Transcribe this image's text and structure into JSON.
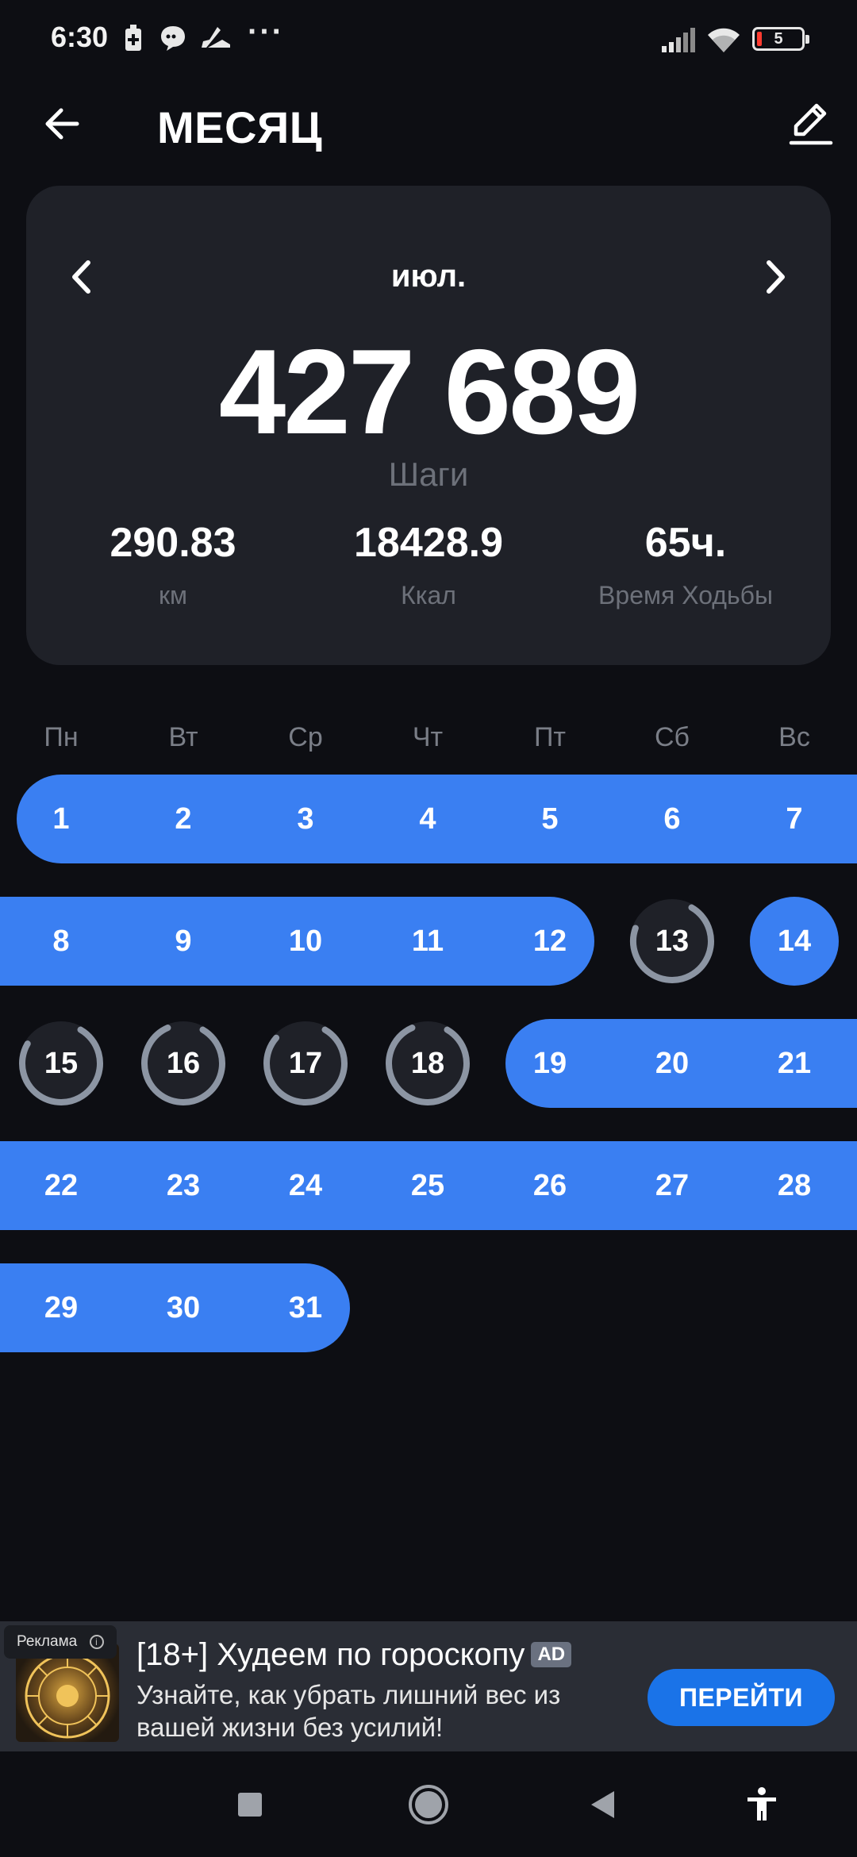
{
  "status_bar": {
    "time": "6:30",
    "battery_level": "5",
    "icons": [
      "battery-saver-icon",
      "chat-bubble-icon",
      "shoe-icon",
      "more-dots-icon",
      "signal-icon",
      "wifi-icon",
      "battery-icon"
    ]
  },
  "header": {
    "title": "МЕСЯЦ",
    "back_icon": "arrow-left-icon",
    "edit_icon": "pencil-icon"
  },
  "summary": {
    "month": "июл.",
    "steps_value": "427 689",
    "steps_label": "Шаги",
    "stats": [
      {
        "value": "290.83",
        "label": "км"
      },
      {
        "value": "18428.9",
        "label": "Ккал"
      },
      {
        "value": "65ч.",
        "label": "Время Ходьбы"
      }
    ]
  },
  "calendar": {
    "weekdays": [
      "Пн",
      "Вт",
      "Ср",
      "Чт",
      "Пт",
      "Сб",
      "Вс"
    ],
    "accent_color": "#3a7ff2",
    "days": [
      {
        "n": "1",
        "goal_met": true
      },
      {
        "n": "2",
        "goal_met": true
      },
      {
        "n": "3",
        "goal_met": true
      },
      {
        "n": "4",
        "goal_met": true
      },
      {
        "n": "5",
        "goal_met": true
      },
      {
        "n": "6",
        "goal_met": true
      },
      {
        "n": "7",
        "goal_met": true
      },
      {
        "n": "8",
        "goal_met": true
      },
      {
        "n": "9",
        "goal_met": true
      },
      {
        "n": "10",
        "goal_met": true
      },
      {
        "n": "11",
        "goal_met": true
      },
      {
        "n": "12",
        "goal_met": true
      },
      {
        "n": "13",
        "goal_met": false,
        "progress": 0.72
      },
      {
        "n": "14",
        "goal_met": true
      },
      {
        "n": "15",
        "goal_met": false,
        "progress": 0.75
      },
      {
        "n": "16",
        "goal_met": false,
        "progress": 0.85
      },
      {
        "n": "17",
        "goal_met": false,
        "progress": 0.78
      },
      {
        "n": "18",
        "goal_met": false,
        "progress": 0.85
      },
      {
        "n": "19",
        "goal_met": true
      },
      {
        "n": "20",
        "goal_met": true
      },
      {
        "n": "21",
        "goal_met": true
      },
      {
        "n": "22",
        "goal_met": true
      },
      {
        "n": "23",
        "goal_met": true
      },
      {
        "n": "24",
        "goal_met": true
      },
      {
        "n": "25",
        "goal_met": true
      },
      {
        "n": "26",
        "goal_met": true
      },
      {
        "n": "27",
        "goal_met": true
      },
      {
        "n": "28",
        "goal_met": true
      },
      {
        "n": "29",
        "goal_met": true
      },
      {
        "n": "30",
        "goal_met": true
      },
      {
        "n": "31",
        "goal_met": true
      }
    ]
  },
  "ad": {
    "tag": "Реклама",
    "title": "[18+] Худеем по гороскопу",
    "badge": "AD",
    "text": "Узнайте, как убрать лишний вес из вашей жизни без усилий!",
    "cta": "ПЕРЕЙТИ"
  },
  "nav_bar": {
    "icons": [
      "recents-square-icon",
      "home-circle-icon",
      "back-triangle-icon",
      "accessibility-icon"
    ]
  }
}
